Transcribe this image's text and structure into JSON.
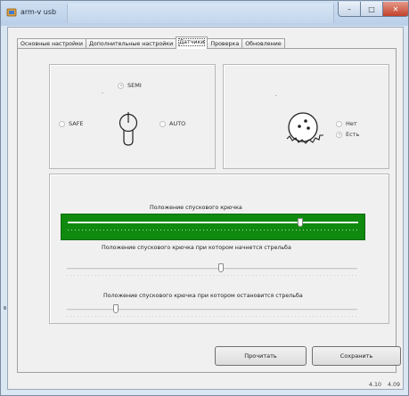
{
  "window": {
    "title": "arm-v usb",
    "close_glyph": "✕",
    "maximize_glyph": "□",
    "minimize_glyph": "–"
  },
  "tabs": [
    {
      "label": "Основные настройки"
    },
    {
      "label": "Дополнительные настройки"
    },
    {
      "label": "Датчики",
      "active": true
    },
    {
      "label": "Проверка"
    },
    {
      "label": "Обновление"
    }
  ],
  "fire_mode": {
    "options": [
      {
        "label": "SEMI",
        "checked": true
      },
      {
        "label": "SAFE",
        "checked": false
      },
      {
        "label": "AUTO",
        "checked": false
      }
    ]
  },
  "magazine": {
    "options": [
      {
        "label": "Нет",
        "checked": false
      },
      {
        "label": "Есть",
        "checked": true
      }
    ]
  },
  "trigger": {
    "position_label": "Положение спускового крючка",
    "position_value": 0.8,
    "fire_start_label": "Положение спускового крючка при котором начнется стрельба",
    "fire_start_value": 0.53,
    "fire_stop_label": "Положение спускового крючка при котором остановится стрельба",
    "fire_stop_value": 0.17
  },
  "buttons": {
    "read": "Прочитать",
    "save": "Сохранить"
  },
  "footer": {
    "version_left": "4.10",
    "version_right": "4.09"
  },
  "colors": {
    "trigger_track": "#0f8a0f",
    "window_frame": "#dbe6f3"
  }
}
